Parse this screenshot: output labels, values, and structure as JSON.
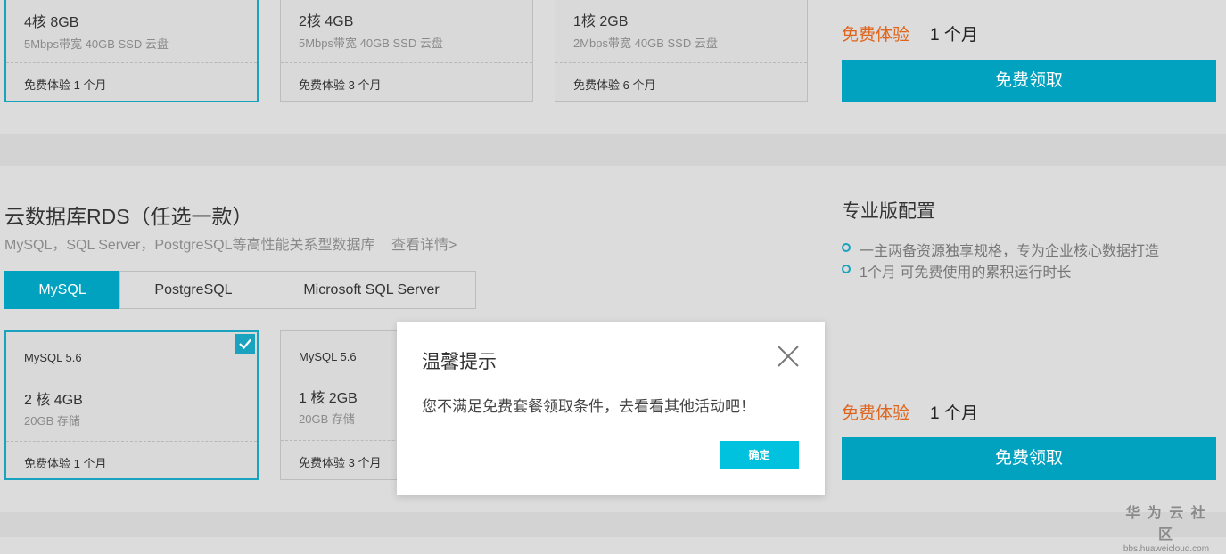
{
  "top_cards": [
    {
      "spec": "4核 8GB",
      "detail": "5Mbps带宽 40GB SSD 云盘",
      "footer": "免费体验 1 个月"
    },
    {
      "spec": "2核 4GB",
      "detail": "5Mbps带宽 40GB SSD 云盘",
      "footer": "免费体验 3 个月"
    },
    {
      "spec": "1核 2GB",
      "detail": "2Mbps带宽 40GB SSD 云盘",
      "footer": "免费体验 6 个月"
    }
  ],
  "top_offer": {
    "label": "免费体验",
    "duration": "1 个月",
    "button": "免费领取"
  },
  "rds": {
    "title": "云数据库RDS（任选一款）",
    "subtitle": "MySQL，SQL Server，PostgreSQL等高性能关系型数据库",
    "details_link": "查看详情>",
    "tabs": [
      "MySQL",
      "PostgreSQL",
      "Microsoft SQL Server"
    ],
    "active_tab": "MySQL",
    "cards": [
      {
        "version": "MySQL 5.6",
        "spec": "2 核 4GB",
        "storage": "20GB 存储",
        "footer": "免费体验 1 个月",
        "selected": true
      },
      {
        "version": "MySQL 5.6",
        "spec": "1 核 2GB",
        "storage": "20GB 存储",
        "footer": "免费体验 3 个月",
        "selected": false
      }
    ]
  },
  "pro_config": {
    "title": "专业版配置",
    "features": [
      "一主两备资源独享规格，专为企业核心数据打造",
      "1个月 可免费使用的累积运行时长"
    ],
    "label": "免费体验",
    "duration": "1 个月",
    "button": "免费领取"
  },
  "dialog": {
    "title": "温馨提示",
    "message": "您不满足免费套餐领取条件，去看看其他活动吧！",
    "confirm": "确定",
    "close_icon": "close-icon"
  },
  "watermark": {
    "main": "华 为 云 社 区",
    "url": "bbs.huaweicloud.com"
  },
  "colors": {
    "accent": "#00a2bf",
    "orange": "#e0651c",
    "confirm": "#00c1de"
  }
}
